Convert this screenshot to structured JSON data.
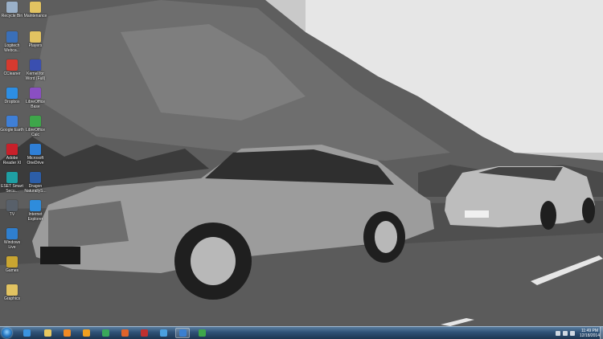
{
  "desktop_icons": {
    "col1": [
      {
        "label": "Recycle Bin",
        "icon": "recycle-bin-icon",
        "color": "#9ab0c8"
      },
      {
        "label": "Logitech Webca...",
        "icon": "webcam-icon",
        "color": "#3a6fb8"
      },
      {
        "label": "CCleaner",
        "icon": "ccleaner-icon",
        "color": "#d63a2f"
      },
      {
        "label": "Dropbox",
        "icon": "dropbox-icon",
        "color": "#2d8ee3"
      },
      {
        "label": "Google Earth",
        "icon": "google-earth-icon",
        "color": "#3f7fd6"
      },
      {
        "label": "Adobe Reader XI",
        "icon": "adobe-reader-icon",
        "color": "#c8202a"
      },
      {
        "label": "ESET Smart Secu...",
        "icon": "eset-icon",
        "color": "#1f9fa3"
      },
      {
        "label": "TV",
        "icon": "tv-icon",
        "color": "#58606a"
      },
      {
        "label": "Windows Live",
        "icon": "windows-live-icon",
        "color": "#2f7fcf"
      },
      {
        "label": "Games",
        "icon": "games-icon",
        "color": "#c9a531"
      },
      {
        "label": "Graphics",
        "icon": "folder-icon",
        "color": "#e2c361"
      }
    ],
    "col2": [
      {
        "label": "Maintenance",
        "icon": "folder-icon",
        "color": "#e2c361"
      },
      {
        "label": "Players",
        "icon": "folder-icon",
        "color": "#e2c361"
      },
      {
        "label": "Kernel for Word (Full)",
        "icon": "kernel-icon",
        "color": "#3a4fb0"
      },
      {
        "label": "LibreOffice Base",
        "icon": "libreoffice-base-icon",
        "color": "#8a4fc2"
      },
      {
        "label": "LibreOffice Calc",
        "icon": "libreoffice-calc-icon",
        "color": "#3ea64a"
      },
      {
        "label": "Microsoft OneDrive",
        "icon": "onedrive-icon",
        "color": "#2f7fd6"
      },
      {
        "label": "Dragon NaturallyS...",
        "icon": "dragon-icon",
        "color": "#2c5ea8"
      },
      {
        "label": "Internet Explorer",
        "icon": "internet-explorer-icon",
        "color": "#2e8cdc"
      }
    ]
  },
  "taskbar": {
    "buttons": [
      {
        "name": "internet-explorer-taskbar-button",
        "icon": "internet-explorer-icon",
        "color": "#3a93e0",
        "active": false
      },
      {
        "name": "explorer-taskbar-button",
        "icon": "folder-icon",
        "color": "#e8c860",
        "active": false
      },
      {
        "name": "media-player-taskbar-button",
        "icon": "media-player-icon",
        "color": "#f08a24",
        "active": false
      },
      {
        "name": "winamp-taskbar-button",
        "icon": "winamp-icon",
        "color": "#f0a020",
        "active": false
      },
      {
        "name": "app-taskbar-button-1",
        "icon": "green-app-icon",
        "color": "#3aa85a",
        "active": false
      },
      {
        "name": "firefox-taskbar-button",
        "icon": "firefox-icon",
        "color": "#e0632a",
        "active": false
      },
      {
        "name": "app-taskbar-button-2",
        "icon": "red-app-icon",
        "color": "#c03030",
        "active": false
      },
      {
        "name": "app-taskbar-button-3",
        "icon": "blue-diamond-icon",
        "color": "#4aa0e0",
        "active": false
      },
      {
        "name": "app-taskbar-button-4",
        "icon": "ie-blue-icon",
        "color": "#3a7fd0",
        "active": true
      },
      {
        "name": "calc-taskbar-button",
        "icon": "spreadsheet-icon",
        "color": "#3ea64a",
        "active": false
      }
    ]
  },
  "clock": {
    "time": "11:49 PM",
    "date": "12/18/2014"
  }
}
